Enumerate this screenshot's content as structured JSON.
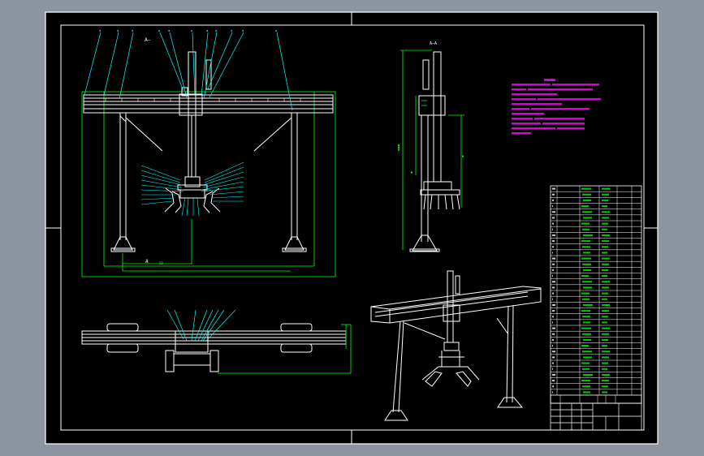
{
  "colors": {
    "background": "#8c959f",
    "sheet": "#000000",
    "outline": "#ffffff",
    "dimension": "#00ff00",
    "leader": "#00ffff",
    "notes": "#ff00ff"
  },
  "views": {
    "front": {
      "section_mark": "A—",
      "section_mark_bottom": "A",
      "dim_small": "50"
    },
    "side": {
      "title": "A–A"
    },
    "top": {},
    "iso": {}
  },
  "parts_list": {
    "footer_labels": [
      "",
      "",
      "",
      "",
      "",
      ""
    ]
  },
  "title_block": {}
}
